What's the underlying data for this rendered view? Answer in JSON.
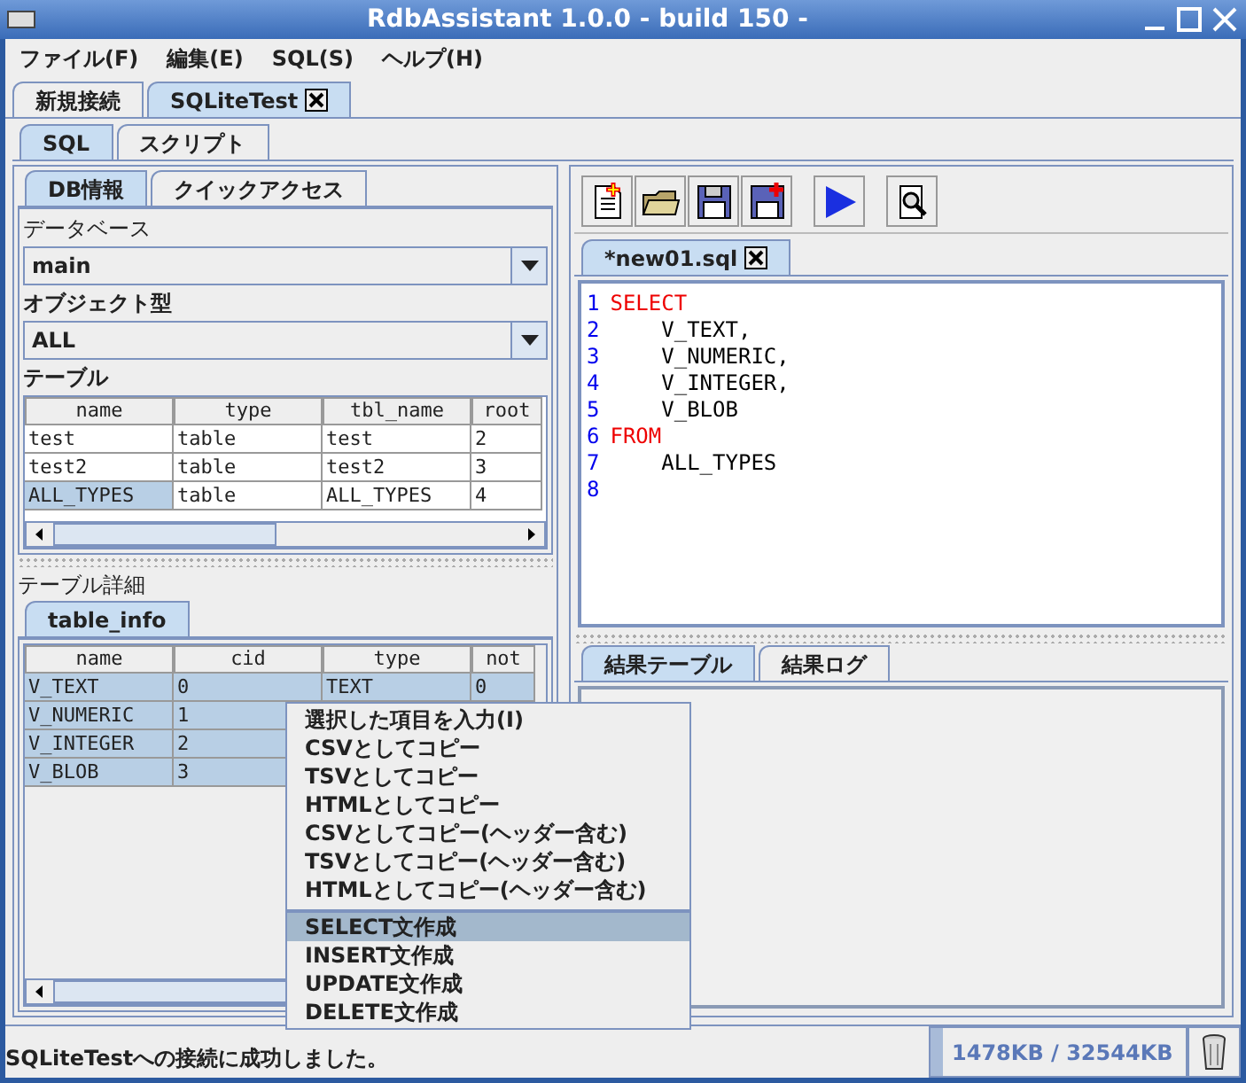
{
  "window": {
    "title": "RdbAssistant 1.0.0 - build 150 -"
  },
  "menu": [
    "ファイル(F)",
    "編集(E)",
    "SQL(S)",
    "ヘルプ(H)"
  ],
  "connection_tabs": [
    {
      "label": "新規接続",
      "selected": false,
      "closable": false
    },
    {
      "label": "SQLiteTest",
      "selected": true,
      "closable": true
    }
  ],
  "mode_tabs": [
    {
      "label": "SQL",
      "selected": true
    },
    {
      "label": "スクリプト",
      "selected": false
    }
  ],
  "left": {
    "tabs": [
      {
        "label": "DB情報",
        "selected": true
      },
      {
        "label": "クイックアクセス",
        "selected": false
      }
    ],
    "database_label": "データベース",
    "database_value": "main",
    "object_type_label": "オブジェクト型",
    "object_type_value": "ALL",
    "table_label": "テーブル",
    "tables": {
      "columns": [
        "name",
        "type",
        "tbl_name",
        "root"
      ],
      "rows": [
        {
          "cells": [
            "test",
            "table",
            "test",
            "2"
          ],
          "selected": false
        },
        {
          "cells": [
            "test2",
            "table",
            "test2",
            "3"
          ],
          "selected": false
        },
        {
          "cells": [
            "ALL_TYPES",
            "table",
            "ALL_TYPES",
            "4"
          ],
          "selected": true
        }
      ]
    },
    "detail_label": "テーブル詳細",
    "detail_tab": "table_info",
    "detail": {
      "columns": [
        "name",
        "cid",
        "type",
        "not"
      ],
      "rows": [
        {
          "cells": [
            "V_TEXT",
            "0",
            "TEXT",
            "0"
          ],
          "selected": true
        },
        {
          "cells": [
            "V_NUMERIC",
            "1"
          ],
          "selected": true
        },
        {
          "cells": [
            "V_INTEGER",
            "2"
          ],
          "selected": true
        },
        {
          "cells": [
            "V_BLOB",
            "3"
          ],
          "selected": true
        }
      ]
    }
  },
  "editor": {
    "tab": "*new01.sql",
    "lines": [
      {
        "number": "1",
        "text": "SELECT",
        "kind": "keyword"
      },
      {
        "number": "2",
        "text": "    V_TEXT,",
        "kind": "plain"
      },
      {
        "number": "3",
        "text": "    V_NUMERIC,",
        "kind": "plain"
      },
      {
        "number": "4",
        "text": "    V_INTEGER,",
        "kind": "plain"
      },
      {
        "number": "5",
        "text": "    V_BLOB",
        "kind": "plain"
      },
      {
        "number": "6",
        "text": "FROM",
        "kind": "keyword"
      },
      {
        "number": "7",
        "text": "    ALL_TYPES",
        "kind": "plain"
      },
      {
        "number": "8"
      }
    ]
  },
  "result_tabs": [
    {
      "label": "結果テーブル",
      "selected": true
    },
    {
      "label": "結果ログ",
      "selected": false
    }
  ],
  "context_menu": [
    {
      "label": "選択した項目を入力(I)",
      "selected": false,
      "separator_before": false
    },
    {
      "label": "CSVとしてコピー",
      "selected": false,
      "separator_before": false
    },
    {
      "label": "TSVとしてコピー",
      "selected": false,
      "separator_before": false
    },
    {
      "label": "HTMLとしてコピー",
      "selected": false,
      "separator_before": false
    },
    {
      "label": "CSVとしてコピー(ヘッダー含む)",
      "selected": false,
      "separator_before": false
    },
    {
      "label": "TSVとしてコピー(ヘッダー含む)",
      "selected": false,
      "separator_before": false
    },
    {
      "label": "HTMLとしてコピー(ヘッダー含む)",
      "selected": false,
      "separator_before": false
    },
    {
      "label": "SELECT文作成",
      "selected": true,
      "separator_before": true
    },
    {
      "label": "INSERT文作成",
      "selected": false,
      "separator_before": false
    },
    {
      "label": "UPDATE文作成",
      "selected": false,
      "separator_before": false
    },
    {
      "label": "DELETE文作成",
      "selected": false,
      "separator_before": false
    }
  ],
  "status": {
    "message": "SQLiteTestへの接続に成功しました。",
    "memory": {
      "reading": "1478KB / 32544KB",
      "level": 0.05
    }
  }
}
